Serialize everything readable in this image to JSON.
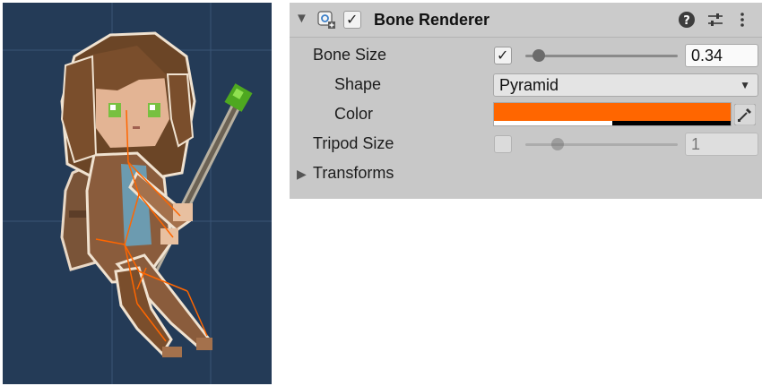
{
  "inspector": {
    "component_title": "Bone Renderer",
    "enabled": true,
    "icons": [
      "script-component-icon",
      "help-icon",
      "preset-sliders-icon",
      "more-menu-icon"
    ],
    "fields": {
      "bone_size": {
        "label": "Bone Size",
        "enabled": true,
        "value": "0.34",
        "slider_fraction": 0.06
      },
      "shape": {
        "label": "Shape",
        "value": "Pyramid"
      },
      "color": {
        "label": "Color",
        "value_hex": "#ff6600",
        "alpha_fraction": 0.5
      },
      "tripod_size": {
        "label": "Tripod Size",
        "enabled": false,
        "value": "1",
        "slider_fraction": 0.2
      },
      "transforms": {
        "label": "Transforms",
        "expanded": false
      }
    }
  },
  "scene": {
    "background": "#243b57",
    "bone_color": "#ff6600",
    "icon": "pixel-art-character-with-staff"
  }
}
